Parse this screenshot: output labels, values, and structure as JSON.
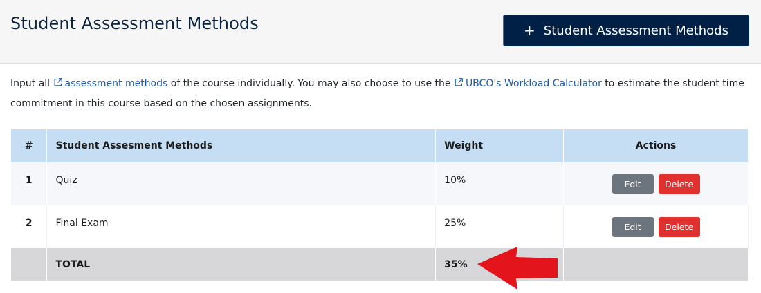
{
  "header": {
    "title": "Student Assessment Methods",
    "add_button": {
      "icon": "plus-icon",
      "label": "Student Assessment Methods"
    }
  },
  "intro": {
    "part1": "Input all ",
    "link1": "assessment methods",
    "part2": " of the course individually. You may also choose to use the ",
    "link2": "UBCO's Workload Calculator",
    "part3": " to estimate the student time commitment in this course based on the chosen assignments."
  },
  "table": {
    "headers": {
      "num": "#",
      "method": "Student Assesment Methods",
      "weight": "Weight",
      "actions": "Actions"
    },
    "rows": [
      {
        "num": "1",
        "method": "Quiz",
        "weight": "10%",
        "edit": "Edit",
        "delete": "Delete"
      },
      {
        "num": "2",
        "method": "Final Exam",
        "weight": "25%",
        "edit": "Edit",
        "delete": "Delete"
      }
    ],
    "total": {
      "label": "TOTAL",
      "weight": "35%"
    }
  },
  "colors": {
    "header_bg": "#f6f6f6",
    "primary_button": "#002145",
    "table_header": "#c5def4",
    "link": "#1f5ba8",
    "edit_button": "#6c757d",
    "delete_button": "#e0312f",
    "total_row": "#d7d7da",
    "annotation_arrow": "#e3141b"
  },
  "annotation": {
    "icon": "red-arrow-icon"
  }
}
